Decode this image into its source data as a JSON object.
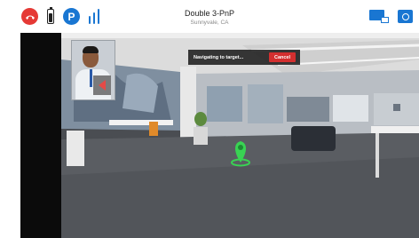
{
  "header": {
    "title": "Double 3-PnP",
    "subtitle": "Sunnyvale, CA"
  },
  "status": {
    "battery_level": 0.8
  },
  "icons": {
    "hangup": "phone-hangup-icon",
    "battery": "battery-icon",
    "park": "parking-icon",
    "pole": "pole-height-icon",
    "screen": "screen-share-icon",
    "camera": "camera-switch-icon",
    "mute": "speaker-mute-icon",
    "target": "navigation-target-icon"
  },
  "navigation": {
    "status_text": "Navigating to target...",
    "cancel_label": "Cancel"
  },
  "colors": {
    "accent": "#1976d2",
    "danger": "#e53935",
    "target": "#39d353"
  }
}
